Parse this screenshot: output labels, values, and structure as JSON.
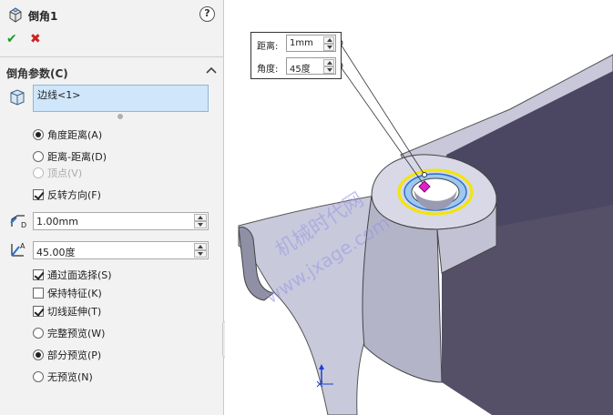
{
  "property_manager": {
    "title": "倒角1",
    "help_label": "?",
    "ok_label": "✔",
    "cancel_label": "✖",
    "group_title": "倒角参数(C)",
    "selection_value": "边线<1>",
    "chamfer_types": [
      {
        "label": "角度距离(A)",
        "selected": true,
        "enabled": true
      },
      {
        "label": "距离-距离(D)",
        "selected": false,
        "enabled": true
      },
      {
        "label": "顶点(V)",
        "selected": false,
        "enabled": false
      }
    ],
    "flip_direction": {
      "label": "反转方向(F)",
      "checked": true
    },
    "distance_value": "1.00mm",
    "angle_value": "45.00度",
    "options": [
      {
        "label": "通过面选择(S)",
        "checked": true
      },
      {
        "label": "保持特征(K)",
        "checked": false
      },
      {
        "label": "切线延伸(T)",
        "checked": true
      }
    ],
    "preview_modes": [
      {
        "label": "完整预览(W)",
        "selected": false
      },
      {
        "label": "部分预览(P)",
        "selected": true
      },
      {
        "label": "无预览(N)",
        "selected": false
      }
    ]
  },
  "callout": {
    "distance_label": "距离:",
    "distance_value": "1mm",
    "angle_label": "角度:",
    "angle_value": "45度"
  },
  "watermark": {
    "line1": "机械时代网",
    "line2": "www.jxage.com"
  },
  "colors": {
    "panel_bg": "#f2f2f2",
    "selection_bg": "#cfe6fb",
    "ok_green": "#1d9a2a",
    "cancel_red": "#cc2222",
    "model_face": "#c9c9dc",
    "model_dark": "#4a4560",
    "edge_highlight": "#f2e600",
    "handle_magenta": "#e020c8"
  },
  "icons": [
    "chamfer-feature-icon",
    "help-icon",
    "check-icon",
    "close-icon",
    "chevron-up-icon",
    "edge-selection-icon",
    "distance-icon",
    "angle-icon",
    "triad-icon"
  ]
}
